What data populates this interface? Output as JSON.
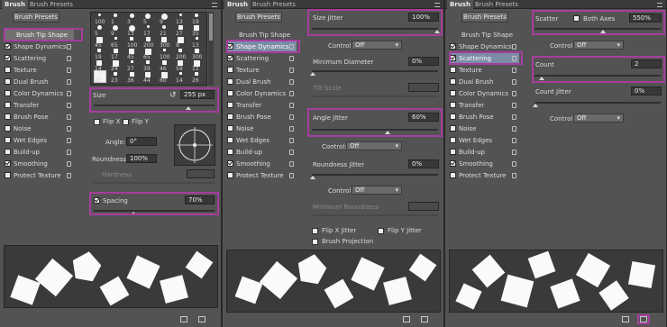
{
  "panels": [
    {
      "tabs": [
        "Brush",
        "Brush Presets"
      ],
      "presets_button": "Brush Presets",
      "items": [
        {
          "label": "Brush Tip Shape",
          "type": "header"
        },
        {
          "label": "Shape Dynamics",
          "checked": true
        },
        {
          "label": "Scattering",
          "checked": true
        },
        {
          "label": "Texture",
          "checked": false
        },
        {
          "label": "Dual Brush",
          "checked": false
        },
        {
          "label": "Color Dynamics",
          "checked": false
        },
        {
          "label": "Transfer",
          "checked": false
        },
        {
          "label": "Brush Pose",
          "checked": false
        },
        {
          "label": "Noise",
          "checked": false
        },
        {
          "label": "Wet Edges",
          "checked": false
        },
        {
          "label": "Build-up",
          "checked": false
        },
        {
          "label": "Smoothing",
          "checked": true
        },
        {
          "label": "Protect Texture",
          "checked": false
        }
      ],
      "swatch_numbers": [
        "100",
        "1",
        "3",
        "5",
        "9",
        "13",
        "19",
        "5",
        "9",
        "13",
        "17",
        "21",
        "27",
        "35",
        "45",
        "65",
        "100",
        "200",
        "300",
        "9",
        "13",
        "19",
        "17",
        "45",
        "65",
        "100",
        "200",
        "300",
        "14",
        "24",
        "27",
        "39",
        "46",
        "59",
        "11",
        "17",
        "23",
        "36",
        "44",
        "60",
        "14",
        "26"
      ],
      "size_label": "Size",
      "size_value": "255 px",
      "flip_x": "Flip X",
      "flip_y": "Flip Y",
      "angle_label": "Angle:",
      "angle_value": "0°",
      "roundness_label": "Roundness:",
      "roundness_value": "100%",
      "hardness_label": "Hardness",
      "spacing_label": "Spacing",
      "spacing_checked": true,
      "spacing_value": "70%"
    },
    {
      "tabs": [
        "Brush",
        "Brush Presets"
      ],
      "presets_button": "Brush Presets",
      "items": [
        {
          "label": "Brush Tip Shape",
          "type": "plain"
        },
        {
          "label": "Shape Dynamics",
          "checked": true,
          "selected": true
        },
        {
          "label": "Scattering",
          "checked": true
        },
        {
          "label": "Texture",
          "checked": false
        },
        {
          "label": "Dual Brush",
          "checked": false
        },
        {
          "label": "Color Dynamics",
          "checked": false
        },
        {
          "label": "Transfer",
          "checked": false
        },
        {
          "label": "Brush Pose",
          "checked": false
        },
        {
          "label": "Noise",
          "checked": false
        },
        {
          "label": "Wet Edges",
          "checked": false
        },
        {
          "label": "Build-up",
          "checked": false
        },
        {
          "label": "Smoothing",
          "checked": true
        },
        {
          "label": "Protect Texture",
          "checked": false
        }
      ],
      "size_jitter_label": "Size Jitter",
      "size_jitter_value": "100%",
      "control_label": "Control:",
      "control_value": "Off",
      "min_diameter_label": "Minimum Diameter",
      "min_diameter_value": "0%",
      "tilt_scale_label": "Tilt Scale",
      "angle_jitter_label": "Angle Jitter",
      "angle_jitter_value": "60%",
      "roundness_jitter_label": "Roundness Jitter",
      "roundness_jitter_value": "0%",
      "min_roundness_label": "Minimum Roundness",
      "flip_x_jitter": "Flip X Jitter",
      "flip_y_jitter": "Flip Y Jitter",
      "brush_projection": "Brush Projection"
    },
    {
      "tabs": [
        "Brush",
        "Brush Presets"
      ],
      "presets_button": "Brush Presets",
      "items": [
        {
          "label": "Brush Tip Shape",
          "type": "plain"
        },
        {
          "label": "Shape Dynamics",
          "checked": true
        },
        {
          "label": "Scattering",
          "checked": true,
          "selected": true
        },
        {
          "label": "Texture",
          "checked": false
        },
        {
          "label": "Dual Brush",
          "checked": false
        },
        {
          "label": "Color Dynamics",
          "checked": false
        },
        {
          "label": "Transfer",
          "checked": false
        },
        {
          "label": "Brush Pose",
          "checked": false
        },
        {
          "label": "Noise",
          "checked": false
        },
        {
          "label": "Wet Edges",
          "checked": false
        },
        {
          "label": "Build-up",
          "checked": false
        },
        {
          "label": "Smoothing",
          "checked": true
        },
        {
          "label": "Protect Texture",
          "checked": false
        }
      ],
      "scatter_label": "Scatter",
      "both_axes_label": "Both Axes",
      "scatter_value": "550%",
      "control_label": "Control:",
      "control_value": "Off",
      "count_label": "Count",
      "count_value": "2",
      "count_jitter_label": "Count Jitter",
      "count_jitter_value": "0%"
    }
  ],
  "colors": {
    "highlight": "#a63d9e",
    "panel_bg": "#535353",
    "selected_item": "#7b8ca6"
  }
}
